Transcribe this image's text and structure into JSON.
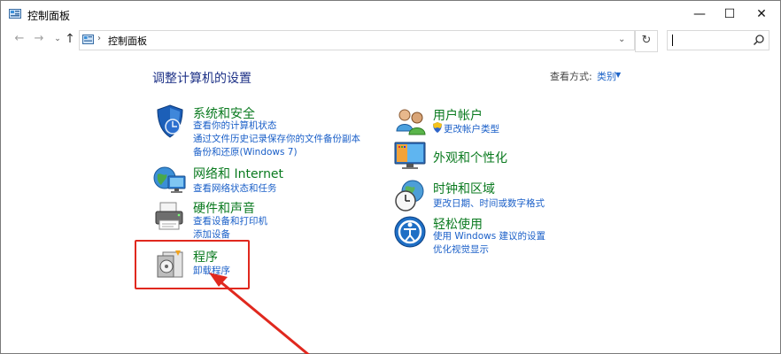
{
  "window": {
    "title": "控制面板",
    "controls": {
      "minimize": "—",
      "maximize": "☐",
      "close": "✕"
    }
  },
  "navbar": {
    "breadcrumb": "控制面板",
    "search_value": ""
  },
  "header": {
    "title": "调整计算机的设置",
    "view_by_label": "查看方式:",
    "view_by_value": "类别"
  },
  "categories": {
    "security": {
      "title": "系统和安全",
      "links": [
        "查看你的计算机状态",
        "通过文件历史记录保存你的文件备份副本",
        "备份和还原(Windows 7)"
      ]
    },
    "network": {
      "title": "网络和 Internet",
      "links": [
        "查看网络状态和任务"
      ]
    },
    "hardware": {
      "title": "硬件和声音",
      "links": [
        "查看设备和打印机",
        "添加设备"
      ]
    },
    "programs": {
      "title": "程序",
      "links": [
        "卸载程序"
      ]
    },
    "accounts": {
      "title": "用户帐户",
      "links": [
        "更改帐户类型"
      ]
    },
    "appearance": {
      "title": "外观和个性化",
      "links": []
    },
    "clock": {
      "title": "时钟和区域",
      "links": [
        "更改日期、时间或数字格式"
      ]
    },
    "ease": {
      "title": "轻松使用",
      "links": [
        "使用 Windows 建议的设置",
        "优化视觉显示"
      ]
    }
  },
  "colors": {
    "category_title": "#0a7a1f",
    "link": "#1a5fc8",
    "page_title": "#1e3287",
    "highlight": "#e0281e"
  }
}
